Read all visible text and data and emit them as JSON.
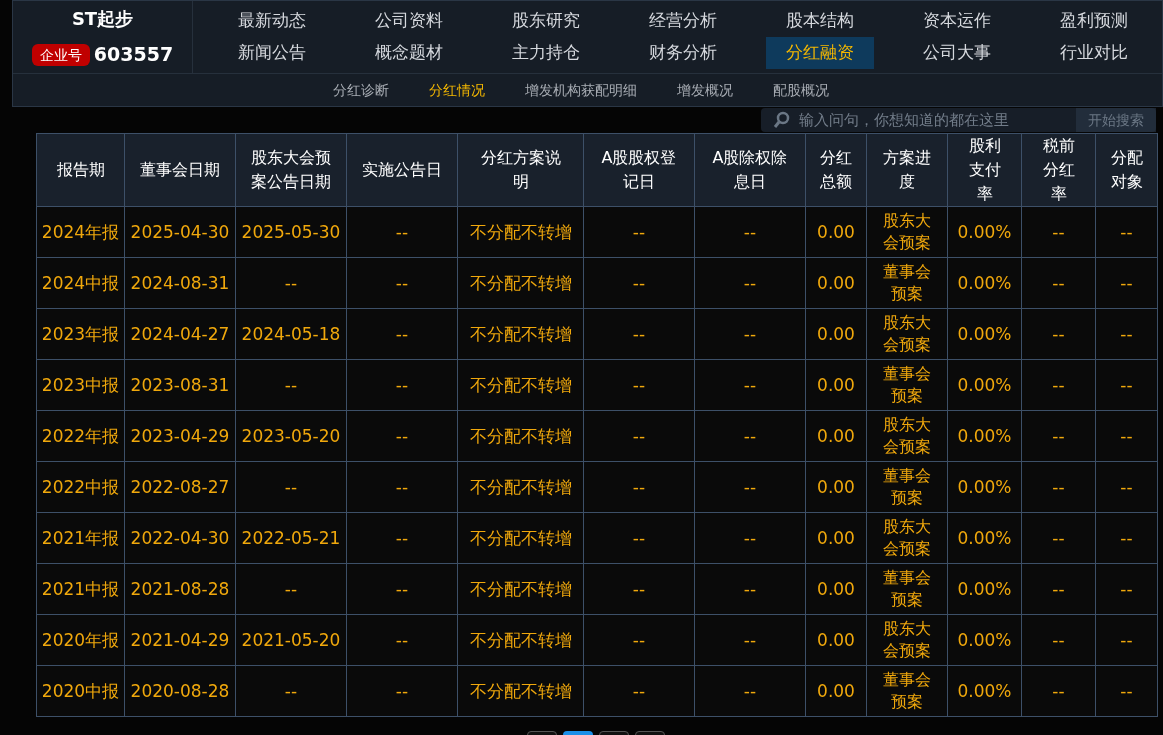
{
  "brand": {
    "name": "ST起步",
    "badge": "企业号",
    "code": "603557"
  },
  "nav": [
    {
      "label": "最新动态",
      "selected": false
    },
    {
      "label": "公司资料",
      "selected": false
    },
    {
      "label": "股东研究",
      "selected": false
    },
    {
      "label": "经营分析",
      "selected": false
    },
    {
      "label": "股本结构",
      "selected": false
    },
    {
      "label": "资本运作",
      "selected": false
    },
    {
      "label": "盈利预测",
      "selected": false
    },
    {
      "label": "新闻公告",
      "selected": false
    },
    {
      "label": "概念题材",
      "selected": false
    },
    {
      "label": "主力持仓",
      "selected": false
    },
    {
      "label": "财务分析",
      "selected": false
    },
    {
      "label": "分红融资",
      "selected": true
    },
    {
      "label": "公司大事",
      "selected": false
    },
    {
      "label": "行业对比",
      "selected": false
    }
  ],
  "subnav": [
    {
      "label": "分红诊断",
      "selected": false
    },
    {
      "label": "分红情况",
      "selected": true
    },
    {
      "label": "增发机构获配明细",
      "selected": false
    },
    {
      "label": "增发概况",
      "selected": false
    },
    {
      "label": "配股概况",
      "selected": false
    }
  ],
  "search": {
    "placeholder": "输入问句，你想知道的都在这里",
    "button": "开始搜索"
  },
  "table": {
    "columns": [
      "报告期",
      "董事会日期",
      "股东大会预案公告日期",
      "实施公告日",
      "分红方案说明",
      "A股股权登记日",
      "A股除权除息日",
      "分红总额",
      "方案进度",
      "股利支付率",
      "税前分红率",
      "分配对象"
    ],
    "rows": [
      [
        "2024年报",
        "2025-04-30",
        "2025-05-30",
        "--",
        "不分配不转增",
        "--",
        "--",
        "0.00",
        "股东大会预案",
        "0.00%",
        "--",
        "--"
      ],
      [
        "2024中报",
        "2024-08-31",
        "--",
        "--",
        "不分配不转增",
        "--",
        "--",
        "0.00",
        "董事会预案",
        "0.00%",
        "--",
        "--"
      ],
      [
        "2023年报",
        "2024-04-27",
        "2024-05-18",
        "--",
        "不分配不转增",
        "--",
        "--",
        "0.00",
        "股东大会预案",
        "0.00%",
        "--",
        "--"
      ],
      [
        "2023中报",
        "2023-08-31",
        "--",
        "--",
        "不分配不转增",
        "--",
        "--",
        "0.00",
        "董事会预案",
        "0.00%",
        "--",
        "--"
      ],
      [
        "2022年报",
        "2023-04-29",
        "2023-05-20",
        "--",
        "不分配不转增",
        "--",
        "--",
        "0.00",
        "股东大会预案",
        "0.00%",
        "--",
        "--"
      ],
      [
        "2022中报",
        "2022-08-27",
        "--",
        "--",
        "不分配不转增",
        "--",
        "--",
        "0.00",
        "董事会预案",
        "0.00%",
        "--",
        "--"
      ],
      [
        "2021年报",
        "2022-04-30",
        "2022-05-21",
        "--",
        "不分配不转增",
        "--",
        "--",
        "0.00",
        "股东大会预案",
        "0.00%",
        "--",
        "--"
      ],
      [
        "2021中报",
        "2021-08-28",
        "--",
        "--",
        "不分配不转增",
        "--",
        "--",
        "0.00",
        "董事会预案",
        "0.00%",
        "--",
        "--"
      ],
      [
        "2020年报",
        "2021-04-29",
        "2021-05-20",
        "--",
        "不分配不转增",
        "--",
        "--",
        "0.00",
        "股东大会预案",
        "0.00%",
        "--",
        "--"
      ],
      [
        "2020中报",
        "2020-08-28",
        "--",
        "--",
        "不分配不转增",
        "--",
        "--",
        "0.00",
        "董事会预案",
        "0.00%",
        "--",
        "--"
      ]
    ]
  },
  "pagination": [
    {
      "selected": false
    },
    {
      "selected": true
    },
    {
      "selected": false
    },
    {
      "selected": false
    }
  ]
}
